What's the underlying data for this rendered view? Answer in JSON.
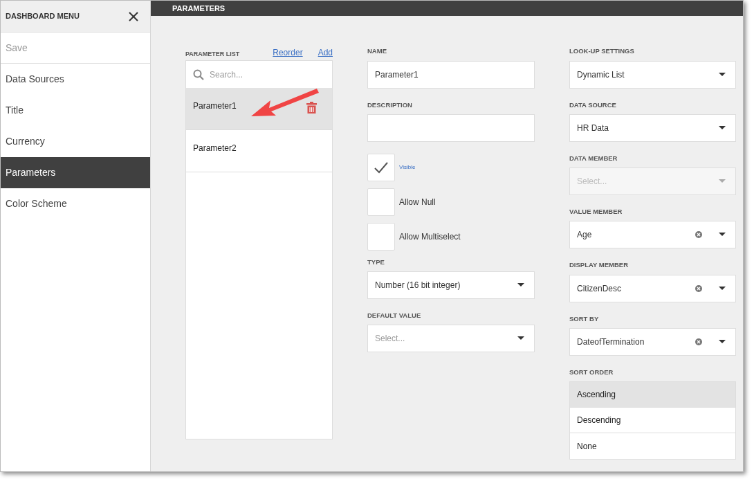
{
  "sidebar": {
    "title": "DASHBOARD MENU",
    "items": [
      {
        "label": "Save",
        "disabled": true,
        "selected": false
      },
      {
        "label": "Data Sources",
        "disabled": false,
        "selected": false
      },
      {
        "label": "Title",
        "disabled": false,
        "selected": false
      },
      {
        "label": "Currency",
        "disabled": false,
        "selected": false
      },
      {
        "label": "Parameters",
        "disabled": false,
        "selected": true
      },
      {
        "label": "Color Scheme",
        "disabled": false,
        "selected": false
      }
    ]
  },
  "header": {
    "title": "PARAMETERS"
  },
  "parameter_list": {
    "label": "PARAMETER LIST",
    "links": [
      "Reorder",
      "Add"
    ],
    "search": {
      "placeholder": "Search..."
    },
    "items": [
      {
        "name": "Parameter1",
        "selected": true
      },
      {
        "name": "Parameter2",
        "selected": false
      }
    ]
  },
  "middle": [
    {
      "kind": "text",
      "label": "NAME",
      "value": "Parameter1"
    },
    {
      "kind": "text",
      "label": "DESCRIPTION"
    },
    {
      "kind": "checkbox",
      "label": "Visible",
      "checked": true
    },
    {
      "kind": "checkbox",
      "label": "Allow Null",
      "checked": false
    },
    {
      "kind": "checkbox",
      "label": "Allow Multiselect",
      "checked": false
    },
    {
      "kind": "select",
      "label": "TYPE",
      "value": "Number (16 bit integer)"
    },
    {
      "kind": "select",
      "label": "DEFAULT VALUE",
      "placeholder": "Select..."
    }
  ],
  "right": [
    {
      "kind": "select",
      "label": "LOOK-UP SETTINGS",
      "value": "Dynamic List",
      "disabled": false,
      "clearable": false
    },
    {
      "kind": "select",
      "label": "DATA SOURCE",
      "value": "HR Data",
      "disabled": false,
      "clearable": false
    },
    {
      "kind": "select",
      "label": "DATA MEMBER",
      "placeholder": "Select...",
      "disabled": true,
      "clearable": false
    },
    {
      "kind": "select",
      "label": "VALUE MEMBER",
      "value": "Age",
      "disabled": false,
      "clearable": true
    },
    {
      "kind": "select",
      "label": "DISPLAY MEMBER",
      "value": "CitizenDesc",
      "disabled": false,
      "clearable": true
    },
    {
      "kind": "select",
      "label": "SORT BY",
      "value": "DateofTermination",
      "disabled": false,
      "clearable": true
    },
    {
      "kind": "list",
      "label": "SORT ORDER",
      "options": [
        {
          "label": "Ascending",
          "selected": true
        },
        {
          "label": "Descending",
          "selected": false
        },
        {
          "label": "None",
          "selected": false
        }
      ]
    }
  ]
}
